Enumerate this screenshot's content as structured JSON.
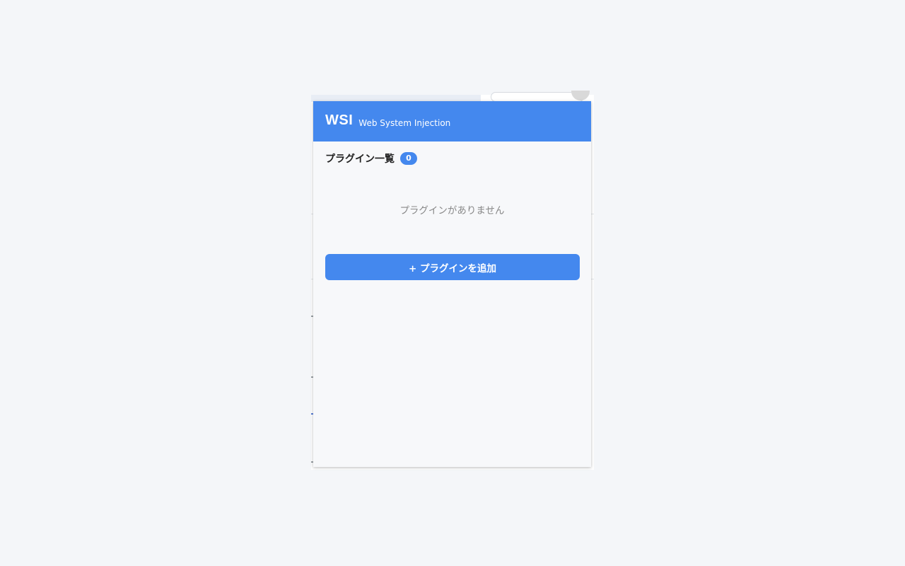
{
  "header": {
    "logo": "WSI",
    "subtitle": "Web System Injection",
    "background_color": "#4488ee"
  },
  "plugins": {
    "title": "プラグイン一覧",
    "count": "0",
    "empty_message": "プラグインがありません",
    "items": []
  },
  "actions": {
    "add_plugin_label": "+ プラグインを追加"
  },
  "colors": {
    "accent": "#4488ee",
    "page_background": "#f4f6f9",
    "popup_background": "#f7f8fa",
    "muted_text": "#888888"
  }
}
